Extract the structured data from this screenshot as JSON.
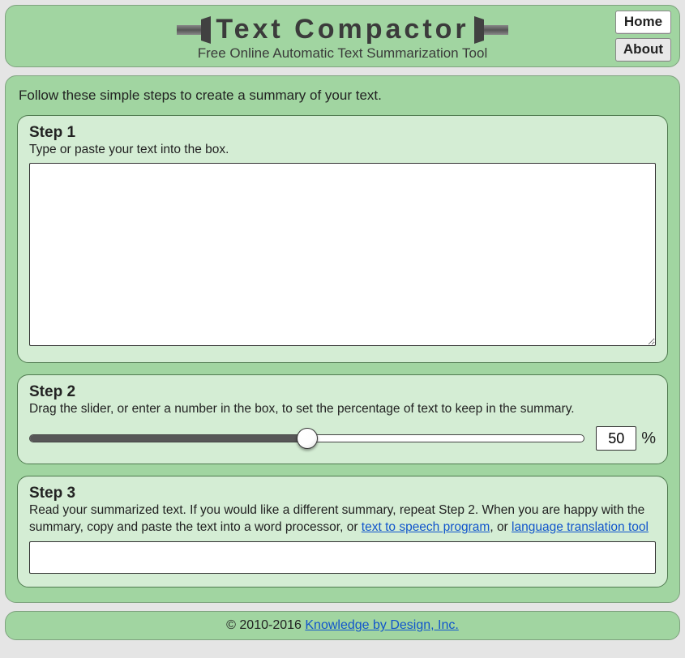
{
  "header": {
    "title": "Text Compactor",
    "tagline": "Free Online Automatic Text Summarization Tool",
    "nav": {
      "home": "Home",
      "about": "About"
    }
  },
  "intro": "Follow these simple steps to create a summary of your text.",
  "steps": {
    "s1": {
      "title": "Step 1",
      "desc": "Type or paste your text into the box.",
      "value": ""
    },
    "s2": {
      "title": "Step 2",
      "desc": "Drag the slider, or enter a number in the box, to set the percentage of text to keep in the summary.",
      "percent": "50",
      "percent_sign": "%"
    },
    "s3": {
      "title": "Step 3",
      "desc_pre": "Read your summarized text. If you would like a different summary, repeat Step 2. When you are happy with the summary, copy and paste the text into a word processor, or ",
      "link1": "text to speech program",
      "desc_mid": ", or ",
      "link2": "language translation tool",
      "output": ""
    }
  },
  "footer": {
    "copy": "© 2010-2016 ",
    "link": "Knowledge by Design, Inc."
  }
}
